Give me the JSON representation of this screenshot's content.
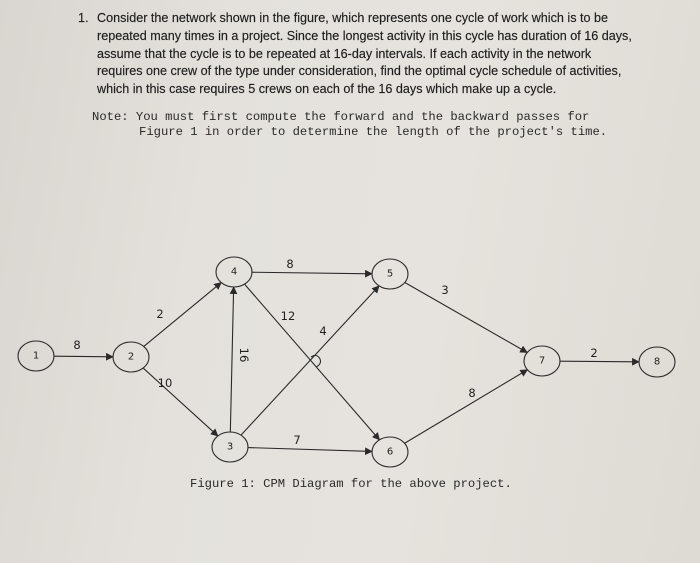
{
  "problem": {
    "number": "1.",
    "lines": [
      "Consider the network shown in the figure, which represents one cycle of work which is to be",
      "repeated many times in a project. Since the longest activity in this cycle has duration of 16 days,",
      "assume that the cycle is to be repeated at 16-day intervals. If each activity in the network",
      "requires one crew of the type under consideration, find the optimal cycle schedule of activities,",
      "which in this case requires 5 crews on each of the 16 days which make up a cycle."
    ]
  },
  "note": {
    "line1": "Note: You must first compute the forward and the backward passes for",
    "line2": "Figure 1 in order to determine the length of the project's time."
  },
  "figure": {
    "caption": "Figure 1: CPM Diagram for the above project.",
    "nodes": [
      "1",
      "2",
      "3",
      "4",
      "5",
      "6",
      "7",
      "8"
    ],
    "edges": [
      {
        "from": "1",
        "to": "2",
        "duration": "8"
      },
      {
        "from": "2",
        "to": "4",
        "duration": "2"
      },
      {
        "from": "2",
        "to": "3",
        "duration": "10"
      },
      {
        "from": "3",
        "to": "4",
        "duration": "16"
      },
      {
        "from": "4",
        "to": "5",
        "duration": "8"
      },
      {
        "from": "4",
        "to": "6",
        "duration": "12"
      },
      {
        "from": "3",
        "to": "5",
        "duration": "4"
      },
      {
        "from": "3",
        "to": "6",
        "duration": "7"
      },
      {
        "from": "5",
        "to": "7",
        "duration": "3"
      },
      {
        "from": "6",
        "to": "7",
        "duration": "8"
      },
      {
        "from": "7",
        "to": "8",
        "duration": "2"
      }
    ]
  }
}
